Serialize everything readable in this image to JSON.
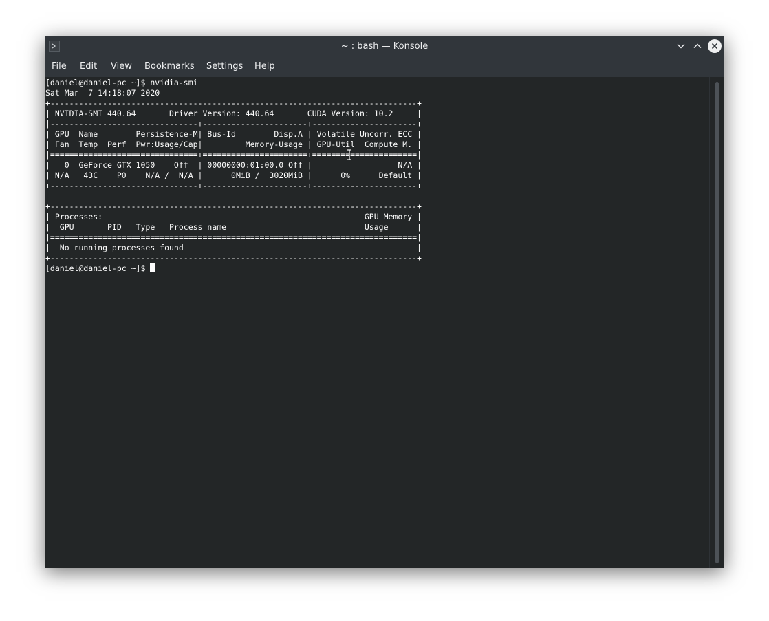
{
  "window": {
    "title": "~ : bash — Konsole",
    "app_icon": "konsole-terminal-icon",
    "controls": [
      "minimize-chevron-down-icon",
      "maximize-chevron-up-icon",
      "close-x-icon"
    ]
  },
  "menubar": {
    "items": [
      {
        "label": "File"
      },
      {
        "label": "Edit"
      },
      {
        "label": "View"
      },
      {
        "label": "Bookmarks"
      },
      {
        "label": "Settings"
      },
      {
        "label": "Help"
      }
    ]
  },
  "terminal": {
    "prompt": "[daniel@daniel-pc ~]$ ",
    "lines": [
      "[daniel@daniel-pc ~]$ nvidia-smi",
      "Sat Mar  7 14:18:07 2020",
      "+-----------------------------------------------------------------------------+",
      "| NVIDIA-SMI 440.64       Driver Version: 440.64       CUDA Version: 10.2     |",
      "|-------------------------------+----------------------+----------------------+",
      "| GPU  Name        Persistence-M| Bus-Id        Disp.A | Volatile Uncorr. ECC |",
      "| Fan  Temp  Perf  Pwr:Usage/Cap|         Memory-Usage | GPU-Util  Compute M. |",
      "|===============================+======================+======================|",
      "|   0  GeForce GTX 1050    Off  | 00000000:01:00.0 Off |                  N/A |",
      "| N/A   43C    P0    N/A /  N/A |      0MiB /  3020MiB |      0%      Default |",
      "+-------------------------------+----------------------+----------------------+",
      "",
      "+-----------------------------------------------------------------------------+",
      "| Processes:                                                       GPU Memory |",
      "|  GPU       PID   Type   Process name                             Usage      |",
      "|=============================================================================|",
      "|  No running processes found                                                 |",
      "+-----------------------------------------------------------------------------+"
    ]
  },
  "colors": {
    "terminal_bg": "#232627",
    "terminal_fg": "#fcfcfc",
    "chrome_bg": "#31363b",
    "chrome_fg": "#eff0f1"
  }
}
